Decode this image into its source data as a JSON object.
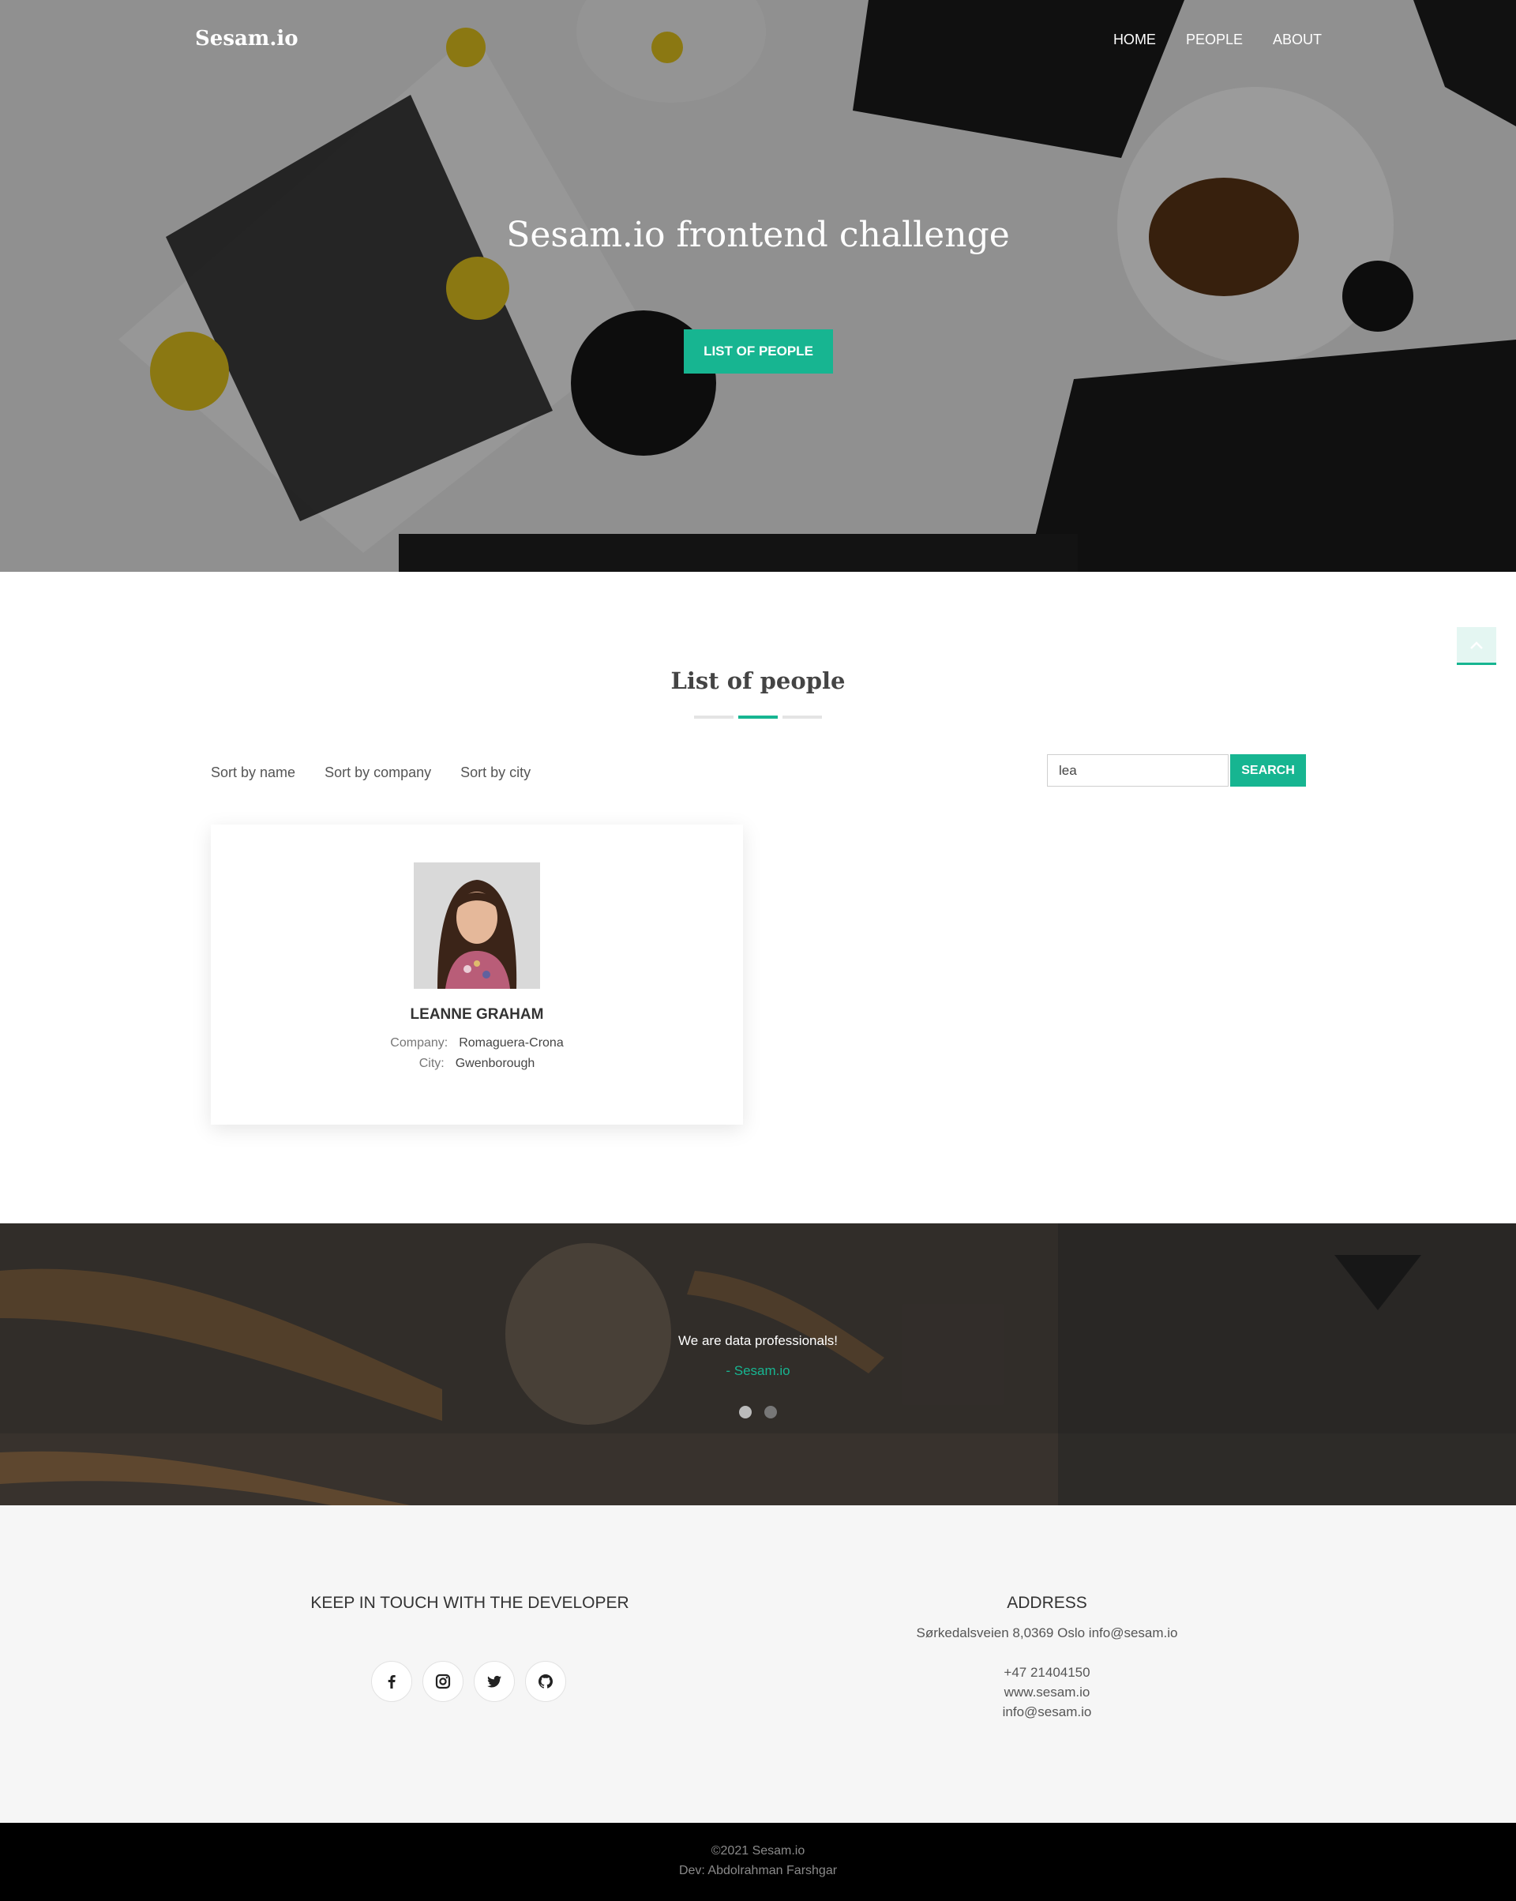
{
  "header": {
    "brand": "Sesam.io",
    "nav": [
      "HOME",
      "PEOPLE",
      "ABOUT"
    ]
  },
  "hero": {
    "title": "Sesam.io frontend challenge",
    "button": "LIST OF PEOPLE"
  },
  "people_section": {
    "title": "List of people",
    "sort_options": [
      "Sort by name",
      "Sort by company",
      "Sort by city"
    ],
    "search": {
      "value": "lea",
      "button": "SEARCH"
    },
    "people": [
      {
        "name": "LEANNE GRAHAM",
        "company_label": "Company:",
        "company": "Romaguera-Crona",
        "city_label": "City:",
        "city": "Gwenborough"
      }
    ]
  },
  "testimonial": {
    "quote": "We are data professionals!",
    "author": "- Sesam.io"
  },
  "footer": {
    "social_heading": "KEEP IN TOUCH WITH THE DEVELOPER",
    "social_icons": [
      "facebook-icon",
      "instagram-icon",
      "twitter-icon",
      "github-icon"
    ],
    "address_heading": "ADDRESS",
    "address_line": "Sørkedalsveien 8,0369 Oslo info@sesam.io",
    "phone": "+47 21404150",
    "website": "www.sesam.io",
    "email": "info@sesam.io"
  },
  "copyright": {
    "line1": "©2021 Sesam.io",
    "line2": "Dev: Abdolrahman Farshgar"
  },
  "colors": {
    "accent": "#17b591",
    "footer_bg": "#f6f6f6",
    "bottom_bg": "#000000"
  }
}
